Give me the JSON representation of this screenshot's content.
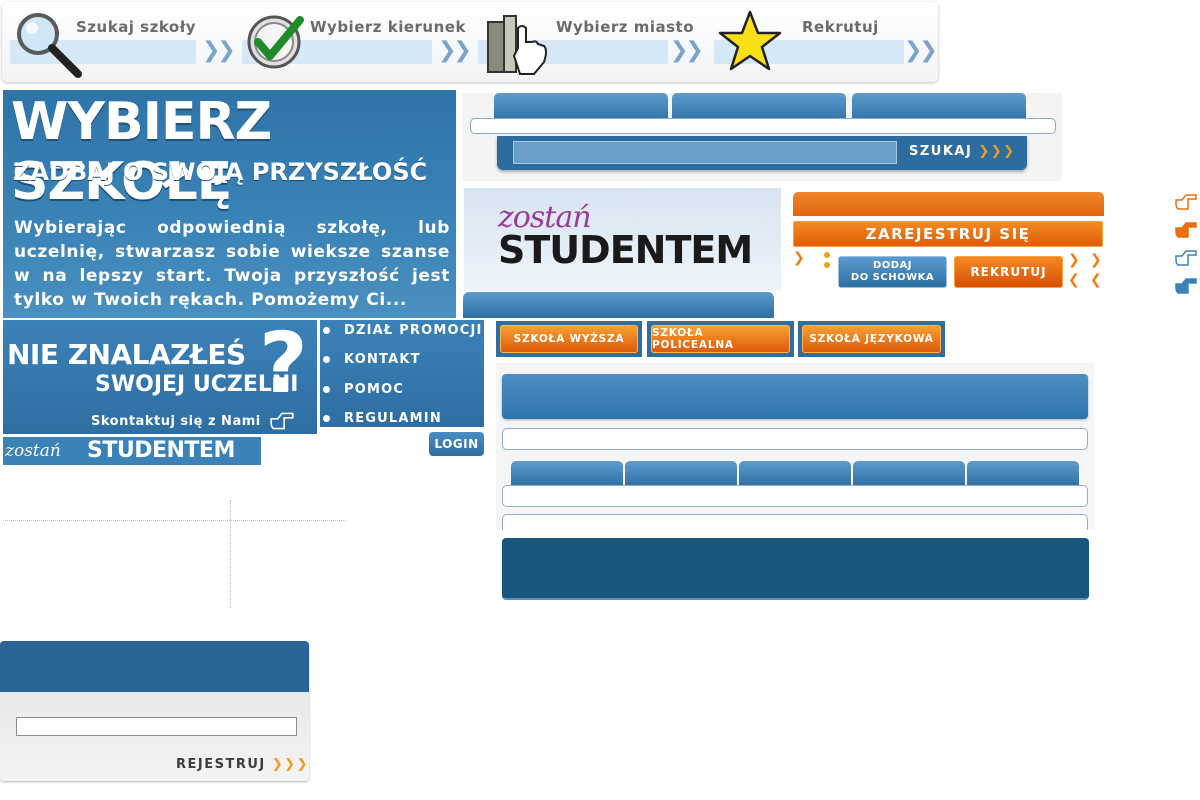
{
  "steps": [
    {
      "label": "Szukaj szkoły",
      "icon": "magnifier-icon"
    },
    {
      "label": "Wybierz kierunek",
      "icon": "checkmark-icon"
    },
    {
      "label": "Wybierz miasto",
      "icon": "city-hand-icon"
    },
    {
      "label": "Rekrutuj",
      "icon": "star-icon"
    }
  ],
  "step_arrows": "❯❯",
  "hero": {
    "title": "WYBIERZ SZKOŁĘ",
    "subtitle": "ZADBAJ O SWOJĄ PRZYSZŁOŚĆ",
    "text": "Wybierając odpowiednią szkołę, lub uczelnię, stwarzasz sobie wieksze szanse w na lepszy start. Twoja przyszłość jest tylko w Twoich rękach. Pomożemy Ci..."
  },
  "search": {
    "button_label": "SZUKAJ",
    "button_chevrons": "❯❯❯",
    "input_value": ""
  },
  "banner": {
    "line1": "zostań",
    "line2": "STUDENTEM"
  },
  "register": {
    "button_label": "ZAREJESTRUJ SIĘ",
    "add_line1": "DODAJ",
    "add_line2": "DO SCHOWKA",
    "rekrutuj_label": "REKRUTUJ"
  },
  "not_found": {
    "line1": "NIE ZNALAZŁEŚ",
    "line2": "SWOJEJ UCZELNI",
    "question": "?",
    "contact": "Skontaktuj się z Nami"
  },
  "menu": {
    "items": [
      "DZIAŁ PROMOCJI",
      "KONTAKT",
      "POMOC",
      "REGULAMIN"
    ],
    "login_label": "LOGIN"
  },
  "small_logo": {
    "line1": "zostań",
    "line2": "STUDENTEM"
  },
  "categories": [
    "SZKOŁA WYŻSZA",
    "SZKOŁA POLICEALNA",
    "SZKOŁA JĘZYKOWA"
  ],
  "regbox": {
    "button_label": "REJESTRUJ",
    "button_chevrons": "❯❯❯",
    "input_value": ""
  },
  "colors": {
    "brand_blue": "#2e6fa2",
    "accent_orange": "#e8700e",
    "dark_blue": "#19567e"
  }
}
